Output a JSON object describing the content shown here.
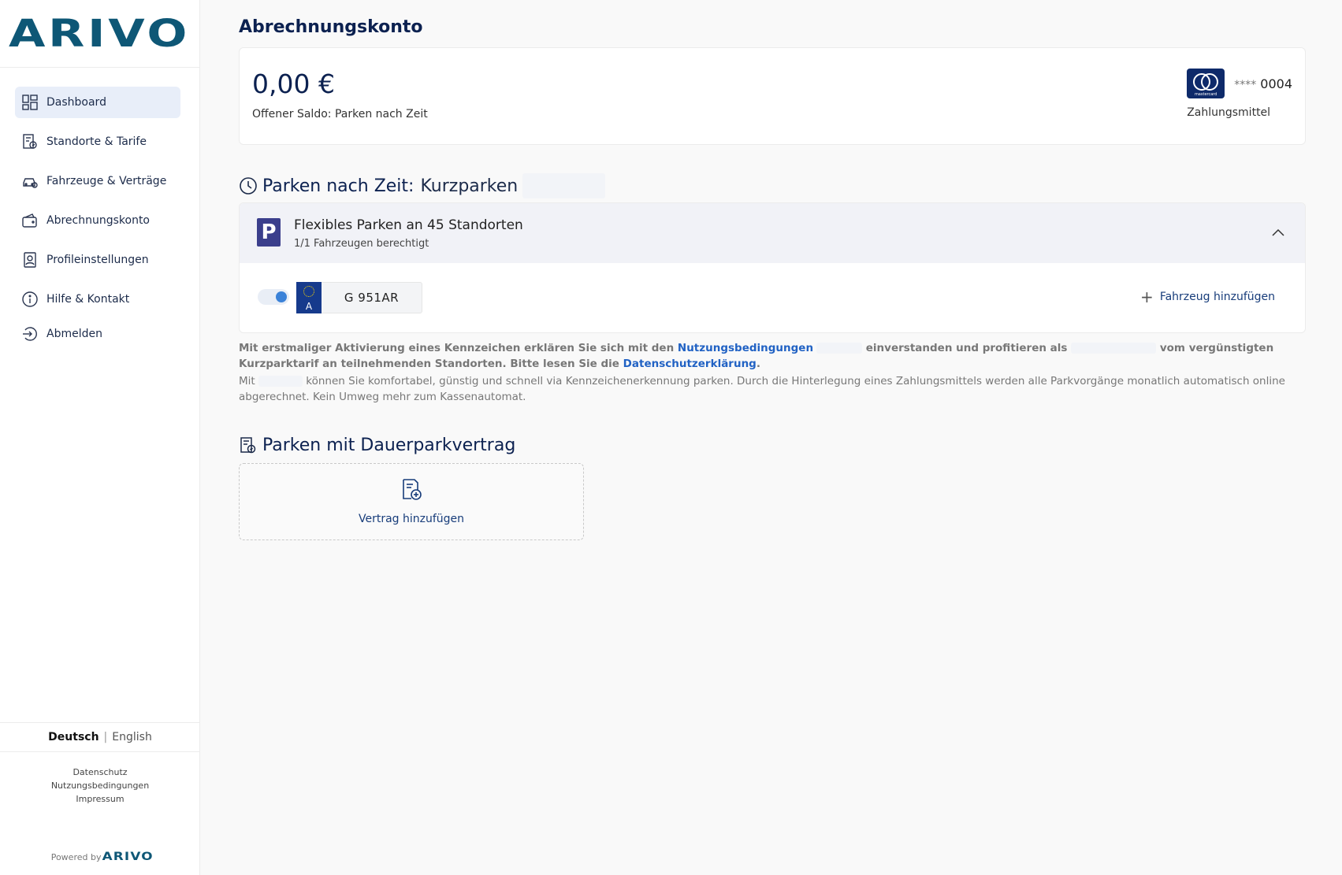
{
  "brand": {
    "logo_text": "ARIVO",
    "powered_by": "Powered by",
    "powered_logo": "ARIVO"
  },
  "sidebar": {
    "items": [
      {
        "label": "Dashboard",
        "icon": "dashboard-icon",
        "active": true
      },
      {
        "label": "Standorte & Tarife",
        "icon": "locations-icon"
      },
      {
        "label": "Fahrzeuge & Verträge",
        "icon": "car-icon"
      },
      {
        "label": "Abrechnungskonto",
        "icon": "wallet-icon"
      },
      {
        "label": "Profileinstellungen",
        "icon": "profile-icon"
      },
      {
        "label": "Hilfe & Kontakt",
        "icon": "info-icon"
      },
      {
        "label": "Abmelden",
        "icon": "logout-icon"
      }
    ],
    "language": {
      "de": "Deutsch",
      "separator": "|",
      "en": "English"
    },
    "footer_links": [
      "Datenschutz",
      "Nutzungsbedingungen",
      "Impressum"
    ]
  },
  "account": {
    "title": "Abrechnungskonto",
    "balance": "0,00 €",
    "balance_label": "Offener Saldo: Parken nach Zeit",
    "card_brand": "mastercard",
    "card_masked": "****",
    "card_last4": "0004",
    "payment_label": "Zahlungsmittel"
  },
  "time_parking": {
    "heading": "Parken nach Zeit:",
    "subheading": "Kurzparken",
    "card_title": "Flexibles Parken an 45 Standorten",
    "card_subtitle": "1/1 Fahrzeugen berechtigt",
    "badge": "P",
    "vehicle": {
      "country": "A",
      "plate": "G 951AR",
      "enabled": true
    },
    "add_vehicle_label": "Fahrzeug hinzufügen"
  },
  "terms": {
    "part1": "Mit erstmaliger Aktivierung eines Kennzeichen erklären Sie sich mit den ",
    "link_terms": "Nutzungsbedingungen",
    "part2": " einverstanden und profitieren als ",
    "part3": " vom vergünstigten Kurzparktarif an teilnehmenden Standorten. Bitte lesen Sie die ",
    "link_privacy": "Datenschutzerklärung",
    "part4": ".",
    "desc_prefix": "Mit ",
    "desc_rest": " können Sie komfortabel, günstig und schnell via Kennzeichenerkennung parken. Durch die Hinterlegung eines Zahlungsmittels werden alle Parkvorgänge monatlich automatisch online abgerechnet. Kein Umweg mehr zum Kassenautomat."
  },
  "contract": {
    "heading": "Parken mit Dauerparkvertrag",
    "add_label": "Vertrag hinzufügen"
  }
}
